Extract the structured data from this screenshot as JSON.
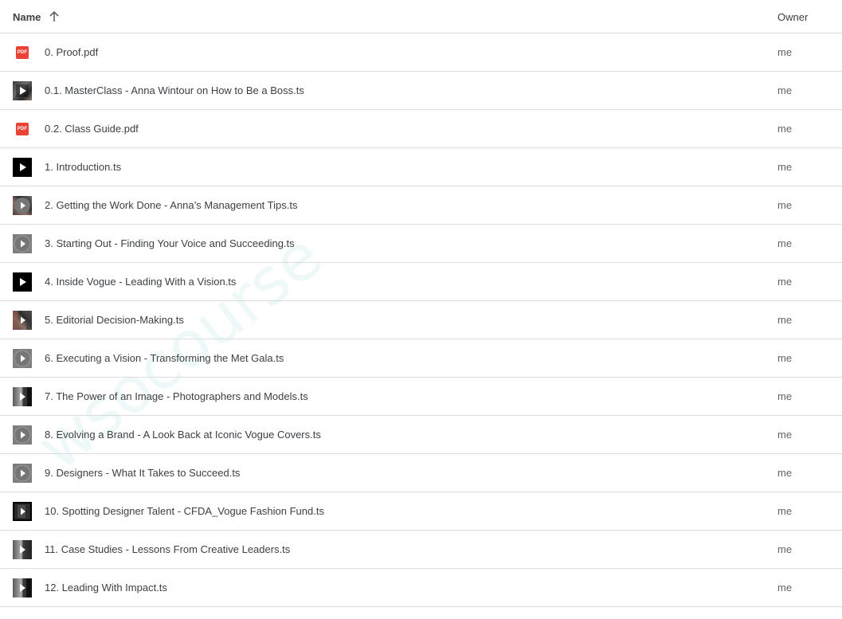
{
  "header": {
    "name_label": "Name",
    "owner_label": "Owner"
  },
  "files": [
    {
      "name": "0. Proof.pdf",
      "owner": "me",
      "icon": "pdf-icon",
      "pdf_text": "PDF"
    },
    {
      "name": "0.1. MasterClass - Anna Wintour on How to Be a Boss.ts",
      "owner": "me",
      "icon": "video-thumbnail-icon"
    },
    {
      "name": "0.2. Class Guide.pdf",
      "owner": "me",
      "icon": "pdf-icon",
      "pdf_text": "PDF"
    },
    {
      "name": "1. Introduction.ts",
      "owner": "me",
      "icon": "video-thumbnail-icon"
    },
    {
      "name": "2. Getting the Work Done - Anna’s Management Tips.ts",
      "owner": "me",
      "icon": "video-thumbnail-icon"
    },
    {
      "name": "3. Starting Out - Finding Your Voice and Succeeding.ts",
      "owner": "me",
      "icon": "video-thumbnail-icon"
    },
    {
      "name": "4. Inside Vogue - Leading With a Vision.ts",
      "owner": "me",
      "icon": "video-thumbnail-icon"
    },
    {
      "name": "5. Editorial Decision-Making.ts",
      "owner": "me",
      "icon": "video-thumbnail-icon"
    },
    {
      "name": "6. Executing a Vision - Transforming the Met Gala.ts",
      "owner": "me",
      "icon": "video-thumbnail-icon"
    },
    {
      "name": "7. The Power of an Image - Photographers and Models.ts",
      "owner": "me",
      "icon": "video-thumbnail-icon"
    },
    {
      "name": "8. Evolving a Brand - A Look Back at Iconic Vogue Covers.ts",
      "owner": "me",
      "icon": "video-thumbnail-icon"
    },
    {
      "name": "9. Designers - What It Takes to Succeed.ts",
      "owner": "me",
      "icon": "video-thumbnail-icon"
    },
    {
      "name": "10. Spotting Designer Talent - CFDA_Vogue Fashion Fund.ts",
      "owner": "me",
      "icon": "video-thumbnail-icon"
    },
    {
      "name": "11. Case Studies - Lessons From Creative Leaders.ts",
      "owner": "me",
      "icon": "video-thumbnail-icon"
    },
    {
      "name": "12. Leading With Impact.ts",
      "owner": "me",
      "icon": "video-thumbnail-icon"
    }
  ],
  "watermark": "wsocourse"
}
